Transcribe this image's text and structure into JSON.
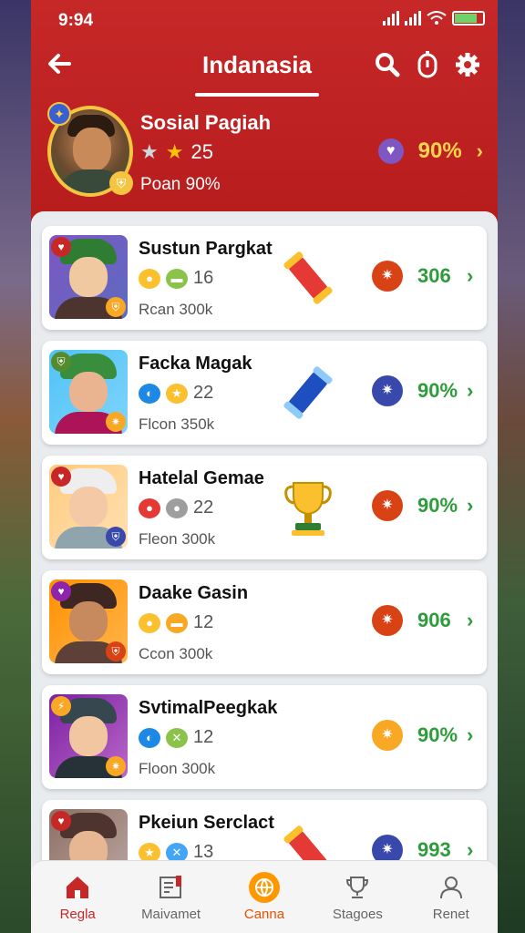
{
  "status": {
    "time": "9:94"
  },
  "header": {
    "title": "Indanasia",
    "icons": [
      "back-arrow-icon",
      "search-icon",
      "timer-icon",
      "gear-icon"
    ]
  },
  "profile": {
    "name": "Sosial Pagiah",
    "stars": "25",
    "sub": "Poan 90%",
    "pct": "90%"
  },
  "players": [
    {
      "name": "Sustun Pargkat",
      "stat": "16",
      "sub": "Rcan  300k",
      "pct": "306",
      "item": "red-scroll",
      "badge_color": "#d84315"
    },
    {
      "name": "Facka Magak",
      "stat": "22",
      "sub": "Flcon  350k",
      "pct": "90%",
      "item": "blue-scroll",
      "badge_color": "#3949ab"
    },
    {
      "name": "Hatelal Gemae",
      "stat": "22",
      "sub": "Fleon  300k",
      "pct": "90%",
      "item": "trophy",
      "badge_color": "#d84315"
    },
    {
      "name": "Daake Gasin",
      "stat": "12",
      "sub": "Ccon  300k",
      "pct": "906",
      "item": "none",
      "badge_color": "#d84315"
    },
    {
      "name": "SvtimalPeegkak",
      "stat": "12",
      "sub": "Floon  300k",
      "pct": "90%",
      "item": "none",
      "badge_color": "#f9a825"
    },
    {
      "name": "Pkeiun Serclact",
      "stat": "13",
      "sub": "",
      "pct": "993",
      "item": "red-scroll",
      "badge_color": "#3949ab"
    }
  ],
  "nav": [
    {
      "label": "Regla",
      "icon": "home-icon"
    },
    {
      "label": "Maivamet",
      "icon": "ledger-icon"
    },
    {
      "label": "Canna",
      "icon": "globe-icon"
    },
    {
      "label": "Stagoes",
      "icon": "trophy-icon"
    },
    {
      "label": "Renet",
      "icon": "profile-icon"
    }
  ]
}
